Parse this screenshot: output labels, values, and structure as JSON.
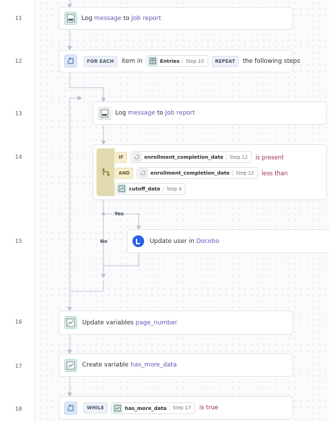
{
  "line_numbers": [
    "11",
    "12",
    "13",
    "14",
    "15",
    "16",
    "17",
    "18"
  ],
  "step11": {
    "action": "Log",
    "value": "message",
    "connector": "to",
    "target": "Job report",
    "icon": "log-icon"
  },
  "step12": {
    "keyword": "FOR EACH",
    "text_item_in": "item in",
    "ref_name": "Entries",
    "ref_step": "Step 10",
    "keyword2": "REPEAT",
    "text_tail": "the following steps",
    "icon": "loop-icon"
  },
  "step13": {
    "action": "Log",
    "value": "message",
    "connector": "to",
    "target": "Job report",
    "icon": "log-icon"
  },
  "step14": {
    "icon": "branch-icon",
    "if_keyword": "IF",
    "cond1": {
      "ref_name": "enrollment_completion_date",
      "ref_step": "Step 12",
      "operator": "is present"
    },
    "and_keyword": "AND",
    "cond2": {
      "ref_name": "enrollment_completion_date",
      "ref_step": "Step 12",
      "operator": "less than"
    },
    "cond3": {
      "ref_name": "cutoff_date",
      "ref_step": "Step 4"
    },
    "yes_label": "Yes",
    "no_label": "No"
  },
  "step15": {
    "action": "Update user in",
    "app": "Docebo",
    "icon": "docebo-logo-icon"
  },
  "step16": {
    "action": "Update variables",
    "value": "page_number",
    "icon": "variable-icon"
  },
  "step17": {
    "action": "Create variable",
    "value": "has_more_data",
    "icon": "variable-icon"
  },
  "step18": {
    "keyword": "WHILE",
    "ref_name": "has_more_data",
    "ref_step": "Step 17",
    "operator": "is true",
    "icon": "loop-icon"
  },
  "colors": {
    "teal_icon": "#d8ecea",
    "blue_icon": "#dce8f7",
    "condition_bar": "#e2d9ac",
    "variable_text": "#5c5bb7",
    "operator_text": "#9b2c52",
    "docebo_blue": "#2a62e6"
  }
}
